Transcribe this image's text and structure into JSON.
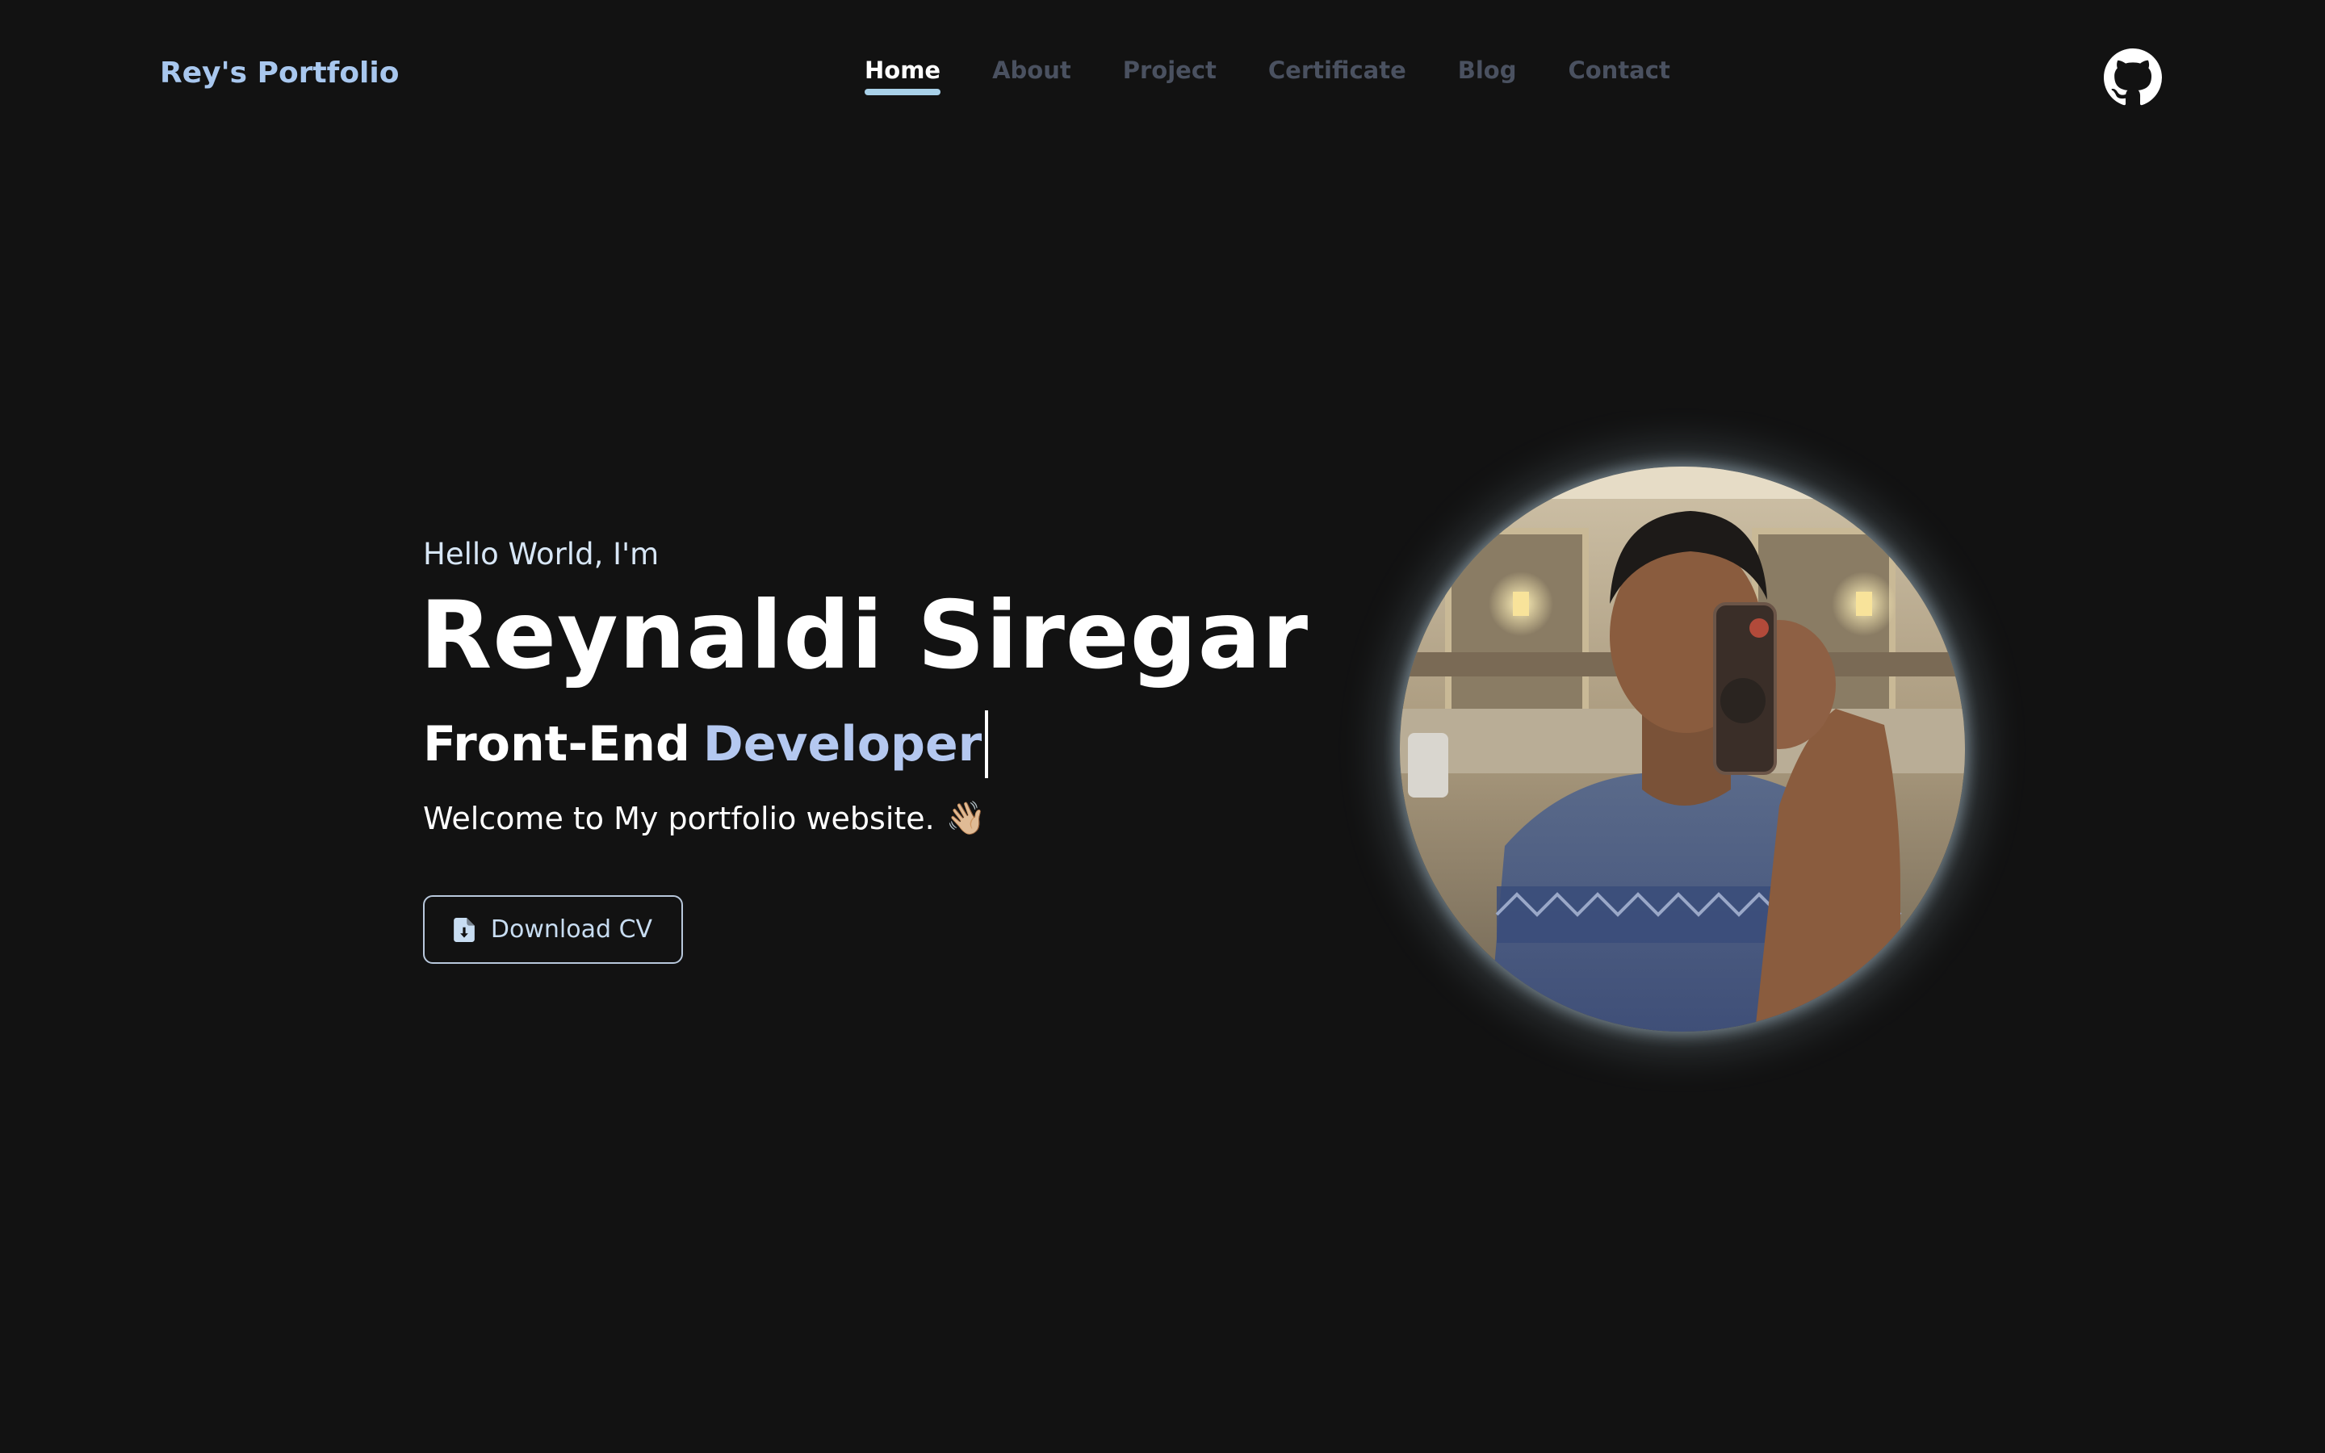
{
  "header": {
    "brand": "Rey's Portfolio",
    "nav": [
      {
        "label": "Home",
        "active": true
      },
      {
        "label": "About",
        "active": false
      },
      {
        "label": "Project",
        "active": false
      },
      {
        "label": "Certificate",
        "active": false
      },
      {
        "label": "Blog",
        "active": false
      },
      {
        "label": "Contact",
        "active": false
      }
    ],
    "github_icon": "github-icon"
  },
  "hero": {
    "greeting": "Hello World, I'm",
    "name": "Reynaldi Siregar",
    "role_prefix": "Front-End",
    "role_suffix": "Developer",
    "welcome": "Welcome to My portfolio website.",
    "wave_emoji": "👋🏼",
    "cv_button_label": "Download CV",
    "cv_icon": "file-download-icon"
  },
  "colors": {
    "background": "#121212",
    "brand": "#a8c7ee",
    "nav_inactive": "#4a5160",
    "accent": "#b4c8f0",
    "underline": "#a8d0e8"
  }
}
